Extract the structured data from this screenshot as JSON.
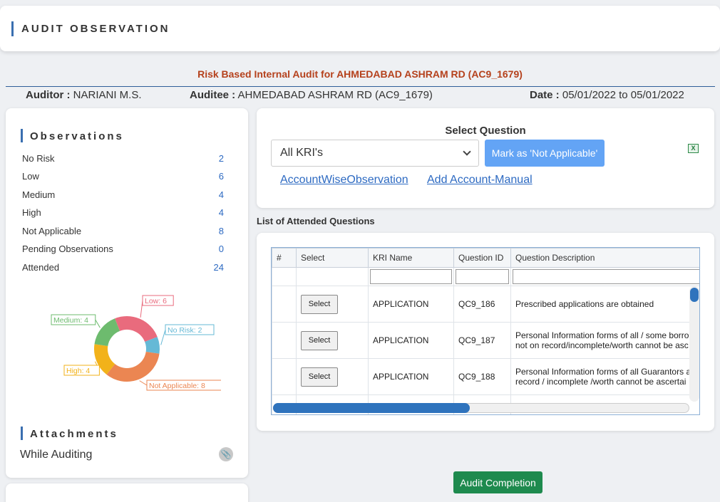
{
  "header": {
    "title": "AUDIT OBSERVATION"
  },
  "audit": {
    "heading": "Risk Based Internal Audit for AHMEDABAD ASHRAM RD (AC9_1679)",
    "auditor_label": "Auditor :",
    "auditor_value": "NARIANI M.S.",
    "auditee_label": "Auditee :",
    "auditee_value": "AHMEDABAD ASHRAM RD (AC9_1679)",
    "date_label": "Date :",
    "date_value": "05/01/2022 to 05/01/2022"
  },
  "observations": {
    "title": "Observations",
    "items": [
      {
        "label": "No Risk",
        "value": "2"
      },
      {
        "label": "Low",
        "value": "6"
      },
      {
        "label": "Medium",
        "value": "4"
      },
      {
        "label": "High",
        "value": "4"
      },
      {
        "label": "Not Applicable",
        "value": "8"
      },
      {
        "label": "Pending Observations",
        "value": "0"
      },
      {
        "label": "Attended",
        "value": "24"
      }
    ]
  },
  "chart_data": {
    "type": "pie",
    "donut": true,
    "slices": [
      {
        "name": "Low",
        "value": 6,
        "label": "Low: 6",
        "color": "#e96b7d"
      },
      {
        "name": "No Risk",
        "value": 2,
        "label": "No Risk: 2",
        "color": "#65b9d6"
      },
      {
        "name": "Not Applicable",
        "value": 8,
        "label": "Not Applicable: 8",
        "color": "#eb8652"
      },
      {
        "name": "High",
        "value": 4,
        "label": "High: 4",
        "color": "#f2b21a"
      },
      {
        "name": "Medium",
        "value": 4,
        "label": "Medium: 4",
        "color": "#6dbb6e"
      }
    ]
  },
  "attachments": {
    "title": "Attachments",
    "item": "While Auditing",
    "icon": "paperclip-icon"
  },
  "select_question": {
    "title": "Select Question",
    "selected": "All KRI's",
    "na_button": "Mark as 'Not Applicable'",
    "export_icon": "excel-icon",
    "link_account": "AccountWiseObservation",
    "link_manual": "Add Account-Manual"
  },
  "grid": {
    "title": "List of Attended Questions",
    "columns": [
      "#",
      "Select",
      "KRI Name",
      "Question ID",
      "Question Description"
    ],
    "rows": [
      {
        "button": "Select",
        "kri": "APPLICATION",
        "qid": "QC9_186",
        "desc1": "Prescribed applications are obtained",
        "desc2": ""
      },
      {
        "button": "Select",
        "kri": "APPLICATION",
        "qid": "QC9_187",
        "desc1": "Personal Information forms of all / some borro",
        "desc2": "not on record/incomplete/worth cannot be asc"
      },
      {
        "button": "Select",
        "kri": "APPLICATION",
        "qid": "QC9_188",
        "desc1": "Personal Information forms of all Guarantors a",
        "desc2": "record / incomplete /worth cannot be ascertai"
      }
    ]
  },
  "footer": {
    "complete_button": "Audit Completion"
  }
}
